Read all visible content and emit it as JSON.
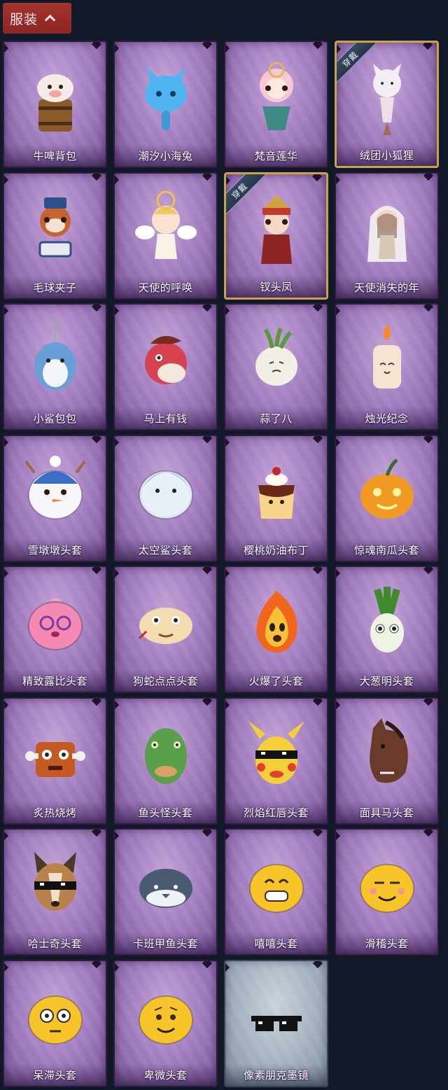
{
  "section": {
    "title": "服装",
    "expanded": true
  },
  "equipped_label": "穿戴",
  "items": [
    {
      "name": "牛啤背包",
      "icon": "cow-beer-barrel-icon"
    },
    {
      "name": "潮汐小海兔",
      "icon": "blue-sea-bunny-icon"
    },
    {
      "name": "梵音莲华",
      "icon": "lotus-doll-icon"
    },
    {
      "name": "绒团小狐狸",
      "icon": "fluffy-fox-icon",
      "equipped": true
    },
    {
      "name": "毛球夹子",
      "icon": "raccoon-drummer-icon"
    },
    {
      "name": "天使的呼唤",
      "icon": "angel-icon"
    },
    {
      "name": "钗头凤",
      "icon": "phoenix-crown-doll-icon",
      "equipped": true
    },
    {
      "name": "天使消失的年",
      "icon": "veiled-doll-icon"
    },
    {
      "name": "小鲨包包",
      "icon": "shark-bag-icon"
    },
    {
      "name": "马上有钱",
      "icon": "red-horse-icon"
    },
    {
      "name": "蒜了八",
      "icon": "garlic-icon"
    },
    {
      "name": "烛光纪念",
      "icon": "candle-icon"
    },
    {
      "name": "雪墩墩头套",
      "icon": "snowman-head-icon"
    },
    {
      "name": "太空鲨头套",
      "icon": "space-shark-head-icon"
    },
    {
      "name": "樱桃奶油布丁",
      "icon": "pudding-head-icon"
    },
    {
      "name": "惊魂南瓜头套",
      "icon": "pumpkin-head-icon"
    },
    {
      "name": "精致露比头套",
      "icon": "pink-beaver-head-icon"
    },
    {
      "name": "狗蛇点点头套",
      "icon": "snake-head-icon"
    },
    {
      "name": "火爆了头套",
      "icon": "fire-head-icon"
    },
    {
      "name": "大葱明头套",
      "icon": "scallion-head-icon"
    },
    {
      "name": "炙热烧烤",
      "icon": "bbq-meat-head-icon"
    },
    {
      "name": "鱼头怪头套",
      "icon": "fish-head-icon"
    },
    {
      "name": "烈焰红唇头套",
      "icon": "yellow-mouse-head-icon"
    },
    {
      "name": "面具马头套",
      "icon": "horse-mask-icon"
    },
    {
      "name": "哈士奇头套",
      "icon": "husky-head-icon"
    },
    {
      "name": "卡班甲鱼头套",
      "icon": "whale-head-icon"
    },
    {
      "name": "嘻嘻头套",
      "icon": "grin-emoji-head-icon"
    },
    {
      "name": "滑稽头套",
      "icon": "smirk-emoji-head-icon"
    },
    {
      "name": "呆滞头套",
      "icon": "dazed-emoji-head-icon"
    },
    {
      "name": "卑微头套",
      "icon": "humble-emoji-head-icon"
    },
    {
      "name": "像素朋克墨镜",
      "icon": "pixel-sunglasses-icon",
      "rarity": "gray"
    }
  ]
}
